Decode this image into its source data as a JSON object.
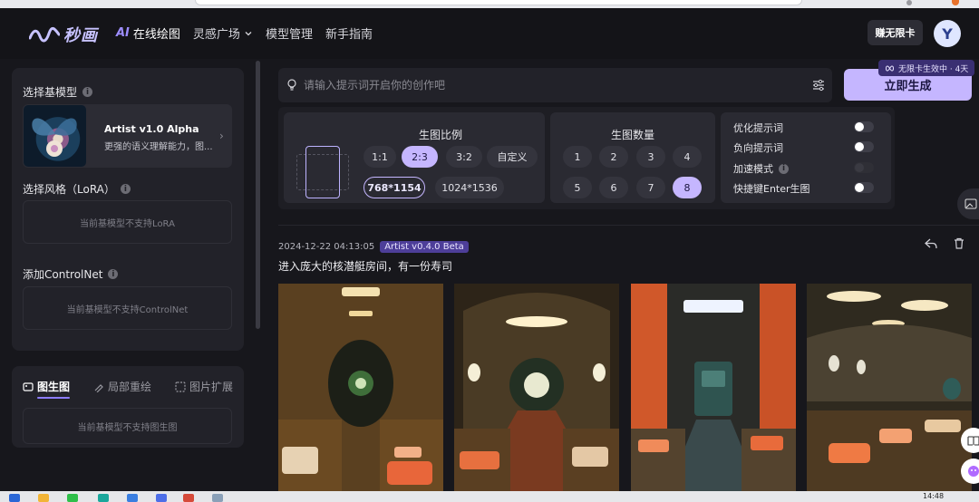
{
  "app": {
    "logo_text": "秒画"
  },
  "nav": {
    "items": [
      {
        "prefix": "AI",
        "label": "在线绘图"
      },
      {
        "label": "灵感广场"
      },
      {
        "label": "模型管理"
      },
      {
        "label": "新手指南"
      }
    ],
    "earn_button": "赚无限卡",
    "avatar_letter": "Y"
  },
  "left": {
    "base_model_label": "选择基模型",
    "model": {
      "title": "Artist v1.0 Alpha",
      "desc": "更强的语义理解能力，图..."
    },
    "lora_label": "选择风格（LoRA）",
    "lora_empty": "当前基模型不支持LoRA",
    "controlnet_label": "添加ControlNet",
    "controlnet_empty": "当前基模型不支持ControlNet",
    "tabs": [
      "图生图",
      "局部重绘",
      "图片扩展"
    ],
    "img2img_empty": "当前基模型不支持图生图"
  },
  "prompt": {
    "placeholder": "请输入提示词开启你的创作吧",
    "generate_button": "立即生成",
    "unlimited_badge": "无限卡生效中 · 4天"
  },
  "settings": {
    "ratio": {
      "title": "生图比例",
      "options": [
        "1:1",
        "2:3",
        "3:2",
        "自定义"
      ],
      "selected": "2:3",
      "sizes": [
        "768*1154",
        "1024*1536"
      ],
      "selected_size": "768*1154"
    },
    "count": {
      "title": "生图数量",
      "options": [
        "1",
        "2",
        "3",
        "4",
        "5",
        "6",
        "7",
        "8"
      ],
      "selected": "8"
    },
    "toggles": [
      {
        "label": "优化提示词",
        "state": "off",
        "info": false
      },
      {
        "label": "负向提示词",
        "state": "off",
        "info": false
      },
      {
        "label": "加速模式",
        "state": "disabled",
        "info": true
      },
      {
        "label": "快捷键Enter生图",
        "state": "off",
        "info": false
      }
    ]
  },
  "result": {
    "timestamp": "2024-12-22 04:13:05",
    "version": "Artist v0.4.0 Beta",
    "prompt": "进入庞大的核潜艇房间，有一份寿司"
  },
  "taskbar": {
    "time": "14:48"
  },
  "colors": {
    "accent": "#c5b6ff",
    "brand": "#9d8dff",
    "background": "#17171c",
    "panel": "#222229"
  }
}
